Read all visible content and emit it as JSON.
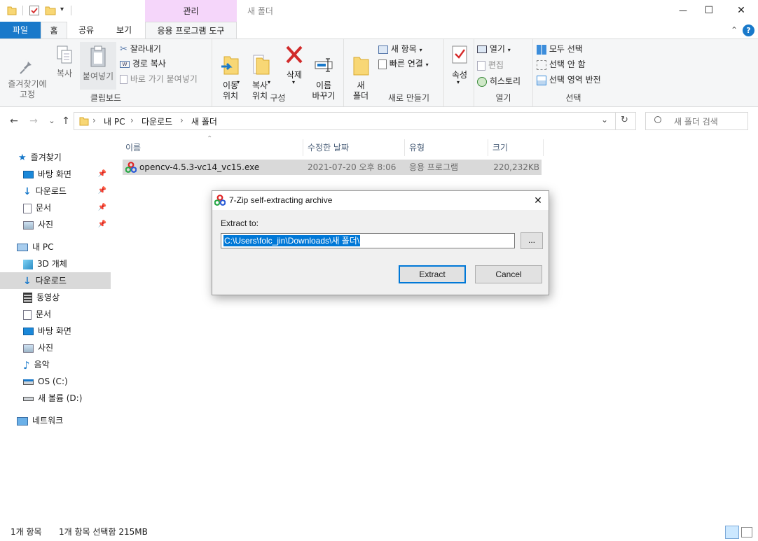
{
  "window": {
    "title": "새 폴더",
    "context_tab_group": "관리",
    "minimize_glyph": "—",
    "maximize_glyph": "☐",
    "close_glyph": "✕",
    "help_glyph": "?",
    "collapse_glyph": "⌃"
  },
  "tabs": {
    "file": "파일",
    "home": "홈",
    "share": "공유",
    "view": "보기",
    "app_tools": "응용 프로그램 도구"
  },
  "ribbon": {
    "clipboard": {
      "label": "클립보드",
      "pin_quick": "즐겨찾기에\n고정",
      "copy": "복사",
      "paste": "붙여넣기",
      "cut": "잘라내기",
      "copy_path": "경로 복사",
      "paste_shortcut": "바로 가기 붙여넣기"
    },
    "organize": {
      "label": "구성",
      "move_to": "이동\n위치",
      "copy_to": "복사\n위치",
      "delete": "삭제",
      "rename": "이름\n바꾸기"
    },
    "new": {
      "label": "새로 만들기",
      "new_folder": "새\n폴더",
      "new_item": "새 항목",
      "easy_access": "빠른 연결"
    },
    "open": {
      "label": "열기",
      "properties": "속성",
      "open": "열기",
      "edit": "편집",
      "history": "히스토리"
    },
    "select": {
      "label": "선택",
      "select_all": "모두 선택",
      "select_none": "선택 안 함",
      "invert": "선택 영역 반전"
    }
  },
  "address": {
    "back": "←",
    "forward": "→",
    "recent": "⌄",
    "up": "↑",
    "crumbs": [
      "내 PC",
      "다운로드",
      "새 폴더"
    ],
    "sep": "›",
    "dropdown": "⌄",
    "refresh": "↻",
    "search_placeholder": "새 폴더 검색"
  },
  "nav": {
    "quick_access": "즐겨찾기",
    "quick": [
      "바탕 화면",
      "다운로드",
      "문서",
      "사진"
    ],
    "this_pc": "내 PC",
    "pc": [
      "3D 개체",
      "다운로드",
      "동영상",
      "문서",
      "바탕 화면",
      "사진",
      "음악",
      "OS (C:)",
      "새 볼륨 (D:)"
    ],
    "network": "네트워크",
    "selected": "다운로드"
  },
  "columns": {
    "name": "이름",
    "modified": "수정한 날짜",
    "type": "유형",
    "size": "크기"
  },
  "files": [
    {
      "name": "opencv-4.5.3-vc14_vc15.exe",
      "modified": "2021-07-20 오후 8:06",
      "type": "응용 프로그램",
      "size": "220,232KB"
    }
  ],
  "status": {
    "count": "1개 항목",
    "selected": "1개 항목 선택함 215MB"
  },
  "dialog": {
    "title": "7-Zip self-extracting archive",
    "extract_to_label": "Extract to:",
    "path": "C:\\Users\\folc_jin\\Downloads\\새 폴더\\",
    "browse": "...",
    "extract": "Extract",
    "cancel": "Cancel",
    "close": "✕"
  },
  "colors": {
    "file_tab": "#1979ca",
    "context_tab": "#f5d6fa",
    "selection": "#cce8ff",
    "row_selected": "#d9d9d9",
    "dialog_highlight": "#0078d7"
  }
}
